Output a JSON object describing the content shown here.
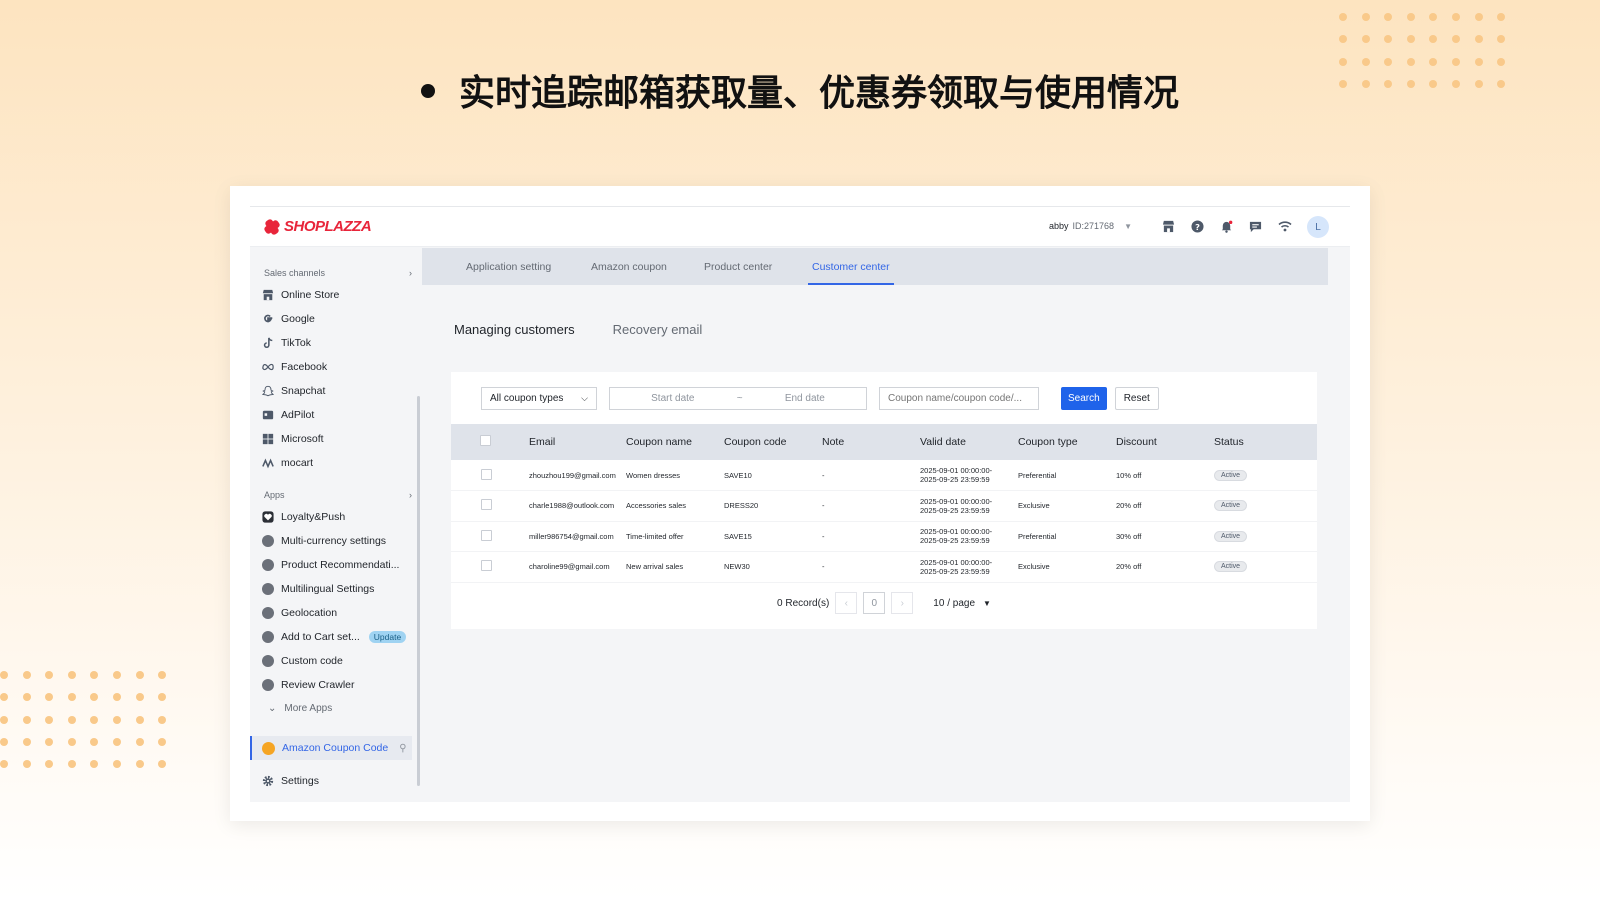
{
  "headline": "实时追踪邮箱获取量、优惠券领取与使用情况",
  "brand": {
    "name": "SHOPLAZZA",
    "color": "#e8253a"
  },
  "account": {
    "user": "abby",
    "id": "ID:271768",
    "avatar_initial": "L"
  },
  "top_icons": [
    "store-icon",
    "help-icon",
    "bell-icon",
    "message-icon",
    "wifi-icon"
  ],
  "sidebar": {
    "sales_title": "Sales channels",
    "sales_items": [
      {
        "label": "Online Store",
        "icon": "store-icon"
      },
      {
        "label": "Google",
        "icon": "google-icon"
      },
      {
        "label": "TikTok",
        "icon": "tiktok-icon"
      },
      {
        "label": "Facebook",
        "icon": "meta-icon"
      },
      {
        "label": "Snapchat",
        "icon": "snapchat-icon"
      },
      {
        "label": "AdPilot",
        "icon": "adpilot-icon"
      },
      {
        "label": "Microsoft",
        "icon": "microsoft-icon"
      },
      {
        "label": "mocart",
        "icon": "mocart-icon"
      }
    ],
    "apps_title": "Apps",
    "app_items": [
      {
        "label": "Loyalty&Push",
        "icon": "loyalty-icon"
      },
      {
        "label": "Multi-currency settings",
        "icon": "currency-icon"
      },
      {
        "label": "Product Recommendati...",
        "icon": "thumb-icon"
      },
      {
        "label": "Multilingual Settings",
        "icon": "language-icon"
      },
      {
        "label": "Geolocation",
        "icon": "geolocation-icon"
      },
      {
        "label": "Add to Cart set...",
        "icon": "cart-icon",
        "badge": "Update"
      },
      {
        "label": "Custom code",
        "icon": "code-icon"
      },
      {
        "label": "Review Crawler",
        "icon": "review-icon"
      }
    ],
    "more_apps": "More Apps",
    "active_app": "Amazon Coupon Code",
    "settings": "Settings"
  },
  "tabs": [
    {
      "label": "Application setting",
      "active": false
    },
    {
      "label": "Amazon coupon",
      "active": false
    },
    {
      "label": "Product center",
      "active": false
    },
    {
      "label": "Customer center",
      "active": true
    }
  ],
  "subtabs": [
    {
      "label": "Managing customers",
      "active": true
    },
    {
      "label": "Recovery email",
      "active": false
    }
  ],
  "filters": {
    "coupon_type": "All coupon types",
    "start_placeholder": "Start date",
    "date_sep": "~",
    "end_placeholder": "End date",
    "search_placeholder": "Coupon name/coupon code/...",
    "search_label": "Search",
    "reset_label": "Reset"
  },
  "table": {
    "columns": [
      "Email",
      "Coupon name",
      "Coupon code",
      "Note",
      "Valid date",
      "Coupon type",
      "Discount",
      "Status"
    ],
    "rows": [
      {
        "email": "zhouzhou199@gmail.com",
        "coupon_name": "Women dresses",
        "coupon_code": "SAVE10",
        "note": "-",
        "valid_start": "2025-09-01 00:00:00-",
        "valid_end": "2025-09-25 23:59:59",
        "coupon_type": "Preferential",
        "discount": "10% off",
        "status": "Active"
      },
      {
        "email": "charle1988@outlook.com",
        "coupon_name": "Accessories sales",
        "coupon_code": "DRESS20",
        "note": "-",
        "valid_start": "2025-09-01 00:00:00-",
        "valid_end": "2025-09-25 23:59:59",
        "coupon_type": "Exclusive",
        "discount": "20% off",
        "status": "Active"
      },
      {
        "email": "miller986754@gmail.com",
        "coupon_name": "Time-limited offer",
        "coupon_code": "SAVE15",
        "note": "-",
        "valid_start": "2025-09-01 00:00:00-",
        "valid_end": "2025-09-25 23:59:59",
        "coupon_type": "Preferential",
        "discount": "30% off",
        "status": "Active"
      },
      {
        "email": "charoline99@gmail.com",
        "coupon_name": "New arrival sales",
        "coupon_code": "NEW30",
        "note": "-",
        "valid_start": "2025-09-01 00:00:00-",
        "valid_end": "2025-09-25 23:59:59",
        "coupon_type": "Exclusive",
        "discount": "20% off",
        "status": "Active"
      }
    ]
  },
  "pagination": {
    "records": "0 Record(s)",
    "current": "0",
    "per_page": "10 / page"
  },
  "colors": {
    "accent": "#1f63ea",
    "tab_active": "#3366e6",
    "coin": "#f5a524",
    "dots": "#f9c98a"
  }
}
